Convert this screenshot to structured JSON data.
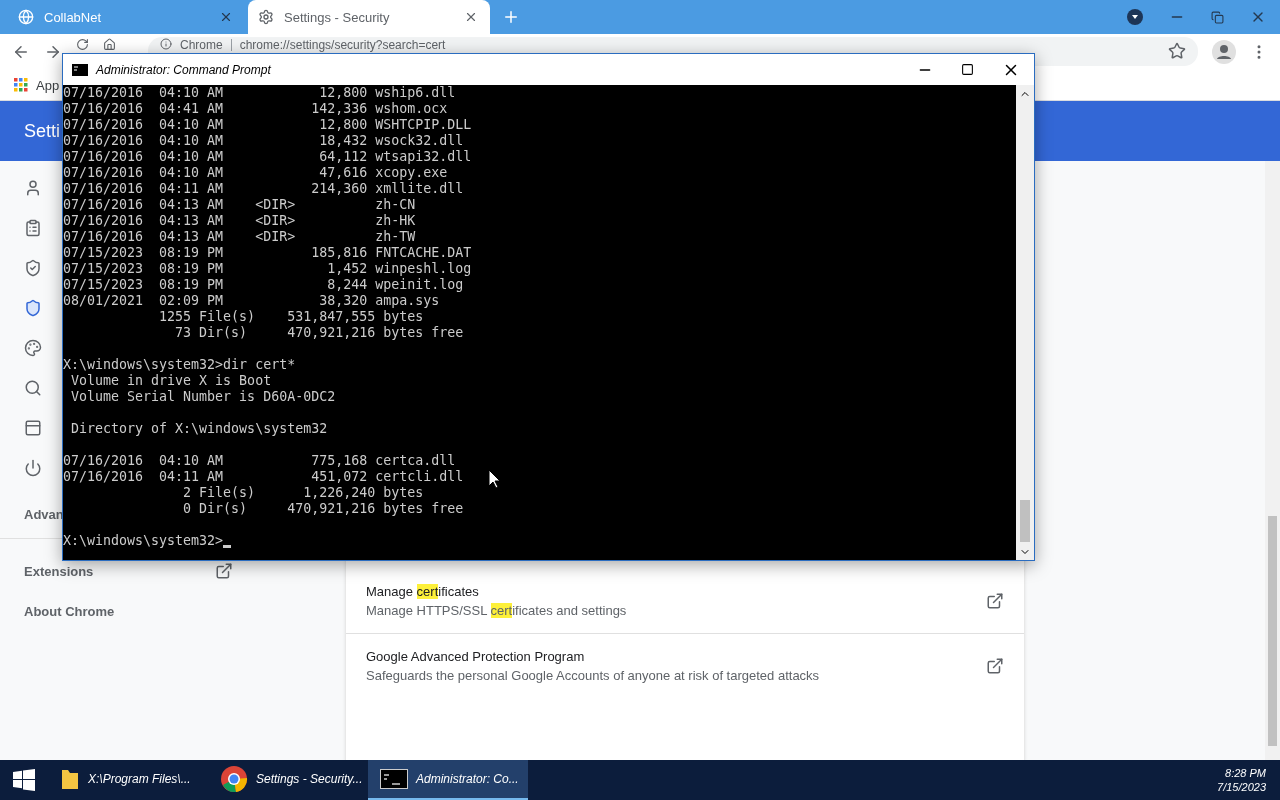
{
  "browser": {
    "tabs": [
      {
        "title": "CollabNet",
        "selected": false
      },
      {
        "title": "Settings - Security",
        "selected": true
      }
    ],
    "address": {
      "site": "Chrome",
      "url": "chrome://settings/security?search=cert"
    },
    "bookmarks": [
      "App"
    ],
    "header_title": "Setti",
    "sidebar": {
      "nav_items": [
        {
          "selected": false
        },
        {
          "selected": false
        },
        {
          "selected": false
        },
        {
          "selected": true
        },
        {
          "selected": false
        },
        {
          "selected": false
        },
        {
          "selected": false
        },
        {
          "selected": false
        }
      ],
      "advanced": "Advan",
      "links": [
        {
          "label": "Extensions",
          "kind": "external"
        },
        {
          "label": "About Chrome",
          "kind": "plain"
        }
      ]
    },
    "rows": [
      {
        "title": "Manage **cert**ificates",
        "description": "Manage HTTPS/SSL **cert**ificates and settings"
      },
      {
        "title": "Google Advanced Protection Program",
        "description": "Safeguards the personal Google Accounts of anyone at risk of targeted attacks"
      }
    ]
  },
  "console": {
    "title": "Administrator: Command Prompt",
    "blocks": [
      [
        "07/16/2016  04:10 AM            12,800 wship6.dll",
        "07/16/2016  04:41 AM           142,336 wshom.ocx",
        "07/16/2016  04:10 AM            12,800 WSHTCPIP.DLL",
        "07/16/2016  04:10 AM            18,432 wsock32.dll",
        "07/16/2016  04:10 AM            64,112 wtsapi32.dll",
        "07/16/2016  04:10 AM            47,616 xcopy.exe",
        "07/16/2016  04:11 AM           214,360 xmllite.dll",
        "07/16/2016  04:13 AM    <DIR>          zh-CN",
        "07/16/2016  04:13 AM    <DIR>          zh-HK",
        "07/16/2016  04:13 AM    <DIR>          zh-TW",
        "07/15/2023  08:19 PM           185,816 FNTCACHE.DAT",
        "07/15/2023  08:19 PM             1,452 winpeshl.log",
        "07/15/2023  08:19 PM             8,244 wpeinit.log",
        "08/01/2021  02:09 PM            38,320 ampa.sys",
        "            1255 File(s)    531,847,555 bytes",
        "              73 Dir(s)     470,921,216 bytes free"
      ],
      [
        "X:\\windows\\system32>dir cert*",
        " Volume in drive X is Boot",
        " Volume Serial Number is D60A-0DC2"
      ],
      [
        " Directory of X:\\windows\\system32"
      ],
      [
        "07/16/2016  04:10 AM           775,168 certca.dll",
        "07/16/2016  04:11 AM           451,072 certcli.dll",
        "               2 File(s)      1,226,240 bytes",
        "               0 Dir(s)     470,921,216 bytes free"
      ]
    ],
    "prompt": "X:\\windows\\system32>"
  },
  "taskbar": {
    "items": [
      {
        "label": "X:\\Program Files\\...",
        "kind": "folder",
        "selected": false
      },
      {
        "label": "Settings - Security...",
        "kind": "browser",
        "selected": false
      },
      {
        "label": "Administrator: Co...",
        "kind": "console",
        "selected": true
      }
    ],
    "time": "8:28 PM",
    "date": "7/15/2023"
  }
}
